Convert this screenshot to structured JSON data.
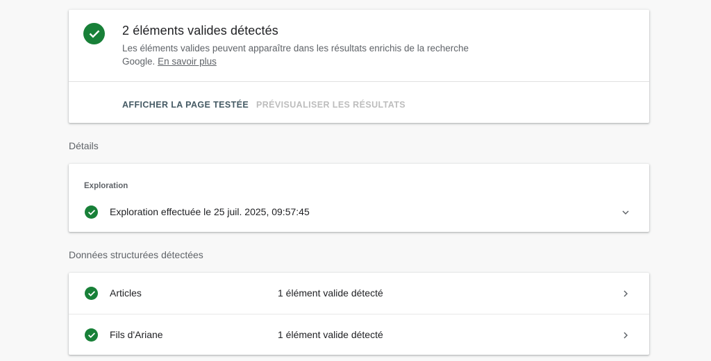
{
  "summary": {
    "title": "2 éléments valides détectés",
    "description": "Les éléments valides peuvent apparaître dans les résultats enrichis de la recherche Google.",
    "learn_more": "En savoir plus",
    "actions": {
      "view_tested_page": "AFFICHER LA PAGE TESTÉE",
      "preview_results": "PRÉVISUALISER LES RÉSULTATS"
    }
  },
  "details": {
    "section_label": "Détails",
    "heading": "Exploration",
    "crawl_status": "Exploration effectuée le 25 juil. 2025, 09:57:45"
  },
  "structured_data": {
    "section_label": "Données structurées détectées",
    "items": [
      {
        "name": "Articles",
        "status": "1 élément valide détecté"
      },
      {
        "name": "Fils d'Ariane",
        "status": "1 élément valide détecté"
      }
    ]
  },
  "colors": {
    "valid_green": "#188038",
    "primary_action": "#455a64",
    "disabled_action": "#bdbdbd",
    "background": "#f8f8f8"
  },
  "icons": {
    "status": "check-circle-icon",
    "expand": "chevron-down-icon",
    "open": "chevron-right-icon"
  }
}
